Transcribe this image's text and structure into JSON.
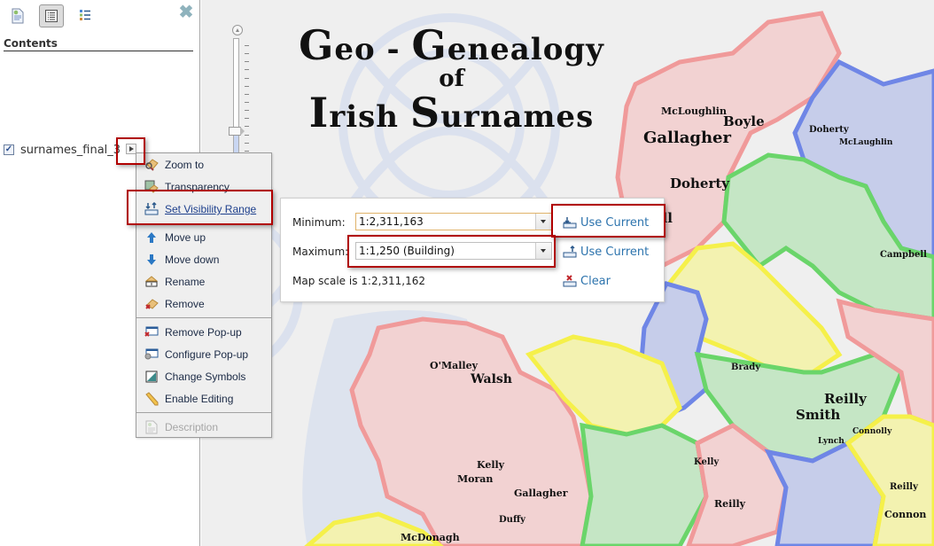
{
  "panel": {
    "toolbar": [
      {
        "name": "details-button",
        "icon": "details-page-icon",
        "active": false
      },
      {
        "name": "contents-button",
        "icon": "contents-list-icon",
        "active": true
      },
      {
        "name": "legend-button",
        "icon": "legend-icon",
        "active": false
      }
    ],
    "close_icon": "close-icon",
    "close_glyph": "✖",
    "title": "Contents",
    "layer": {
      "checked": true,
      "check_glyph": "✓",
      "name": "surnames_final_3"
    }
  },
  "map": {
    "title": {
      "line1_cap1": "G",
      "line1_rest1": "eo - ",
      "line1_cap2": "G",
      "line1_rest2": "enealogy",
      "line2": "of",
      "line3_cap1": "I",
      "line3_rest1": "rish ",
      "line3_cap2": "S",
      "line3_rest2": "urnames"
    },
    "zoom_slider": {
      "level_fraction": 0.25,
      "tick_count": 15
    },
    "labels": [
      {
        "text": "McLoughlin",
        "size": "s"
      },
      {
        "text": "Boyle",
        "size": "m"
      },
      {
        "text": "Gallagher",
        "size": "l"
      },
      {
        "text": "Doherty",
        "size": "m"
      },
      {
        "text": "Doherty",
        "size": "s"
      },
      {
        "text": "McLaughlin",
        "size": "xs"
      },
      {
        "text": "Campbell",
        "size": "s"
      },
      {
        "text": "O'Malley",
        "size": "s"
      },
      {
        "text": "Walsh",
        "size": "m"
      },
      {
        "text": "Kelly",
        "size": "s"
      },
      {
        "text": "Moran",
        "size": "s"
      },
      {
        "text": "Gallagher",
        "size": "s"
      },
      {
        "text": "Duffy",
        "size": "s"
      },
      {
        "text": "McDonagh",
        "size": "s"
      },
      {
        "text": "Brady",
        "size": "s"
      },
      {
        "text": "Reilly",
        "size": "m"
      },
      {
        "text": "Smith",
        "size": "m"
      },
      {
        "text": "Connolly",
        "size": "xs"
      },
      {
        "text": "Lynch",
        "size": "xs"
      },
      {
        "text": "Kelly",
        "size": "s"
      },
      {
        "text": "Reilly",
        "size": "s"
      },
      {
        "text": "Reilly",
        "size": "s"
      },
      {
        "text": "Connon",
        "size": "s"
      },
      {
        "text": "ell",
        "size": "m"
      }
    ],
    "region_colors": {
      "pink": "#f2d2d2",
      "pink_edge": "#f09a9a",
      "green": "#c5e6c5",
      "green_edge": "#6ad56a",
      "blue": "#c6cdea",
      "blue_edge": "#6f86e6",
      "yellow": "#f3f2b0",
      "yellow_edge": "#f5f04a",
      "sea": "#dde3ee"
    }
  },
  "context_menu": {
    "items": [
      {
        "label": "Zoom to",
        "icon": "zoom-to-icon"
      },
      {
        "label": "Transparency",
        "icon": "transparency-icon"
      },
      {
        "label": "Set Visibility Range",
        "icon": "visibility-range-icon",
        "link": true
      },
      {
        "label": "Move up",
        "icon": "arrow-up-icon"
      },
      {
        "label": "Move down",
        "icon": "arrow-down-icon"
      },
      {
        "label": "Rename",
        "icon": "rename-icon"
      },
      {
        "label": "Remove",
        "icon": "remove-icon"
      },
      {
        "label": "Remove Pop-up",
        "icon": "remove-popup-icon"
      },
      {
        "label": "Configure Pop-up",
        "icon": "configure-popup-icon"
      },
      {
        "label": "Change Symbols",
        "icon": "change-symbols-icon"
      },
      {
        "label": "Enable Editing",
        "icon": "pencil-icon"
      },
      {
        "label": "Description",
        "icon": "description-icon",
        "disabled": true
      }
    ]
  },
  "visibility_popup": {
    "minimum_label": "Minimum:",
    "minimum_value": "1:2,311,163",
    "maximum_label": "Maximum:",
    "maximum_value": "1:1,250 (Building)",
    "map_scale_text": "Map scale is 1:2,311,162",
    "use_current_min": "Use Current",
    "use_current_max": "Use Current",
    "clear": "Clear"
  },
  "colors": {
    "highlight": "#b00000",
    "link": "#2c73ad",
    "menu_bg": "#efefef"
  }
}
